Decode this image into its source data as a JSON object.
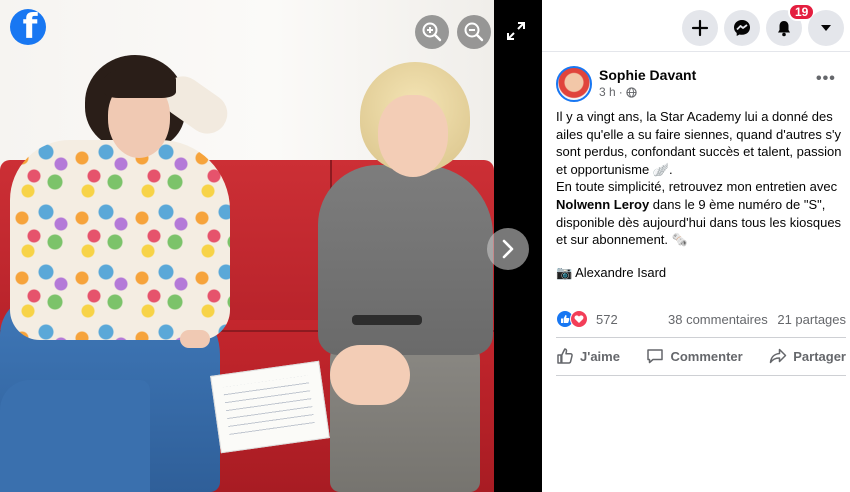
{
  "viewer": {
    "logo_letter": "f",
    "controls": {
      "zoom_in": "zoom-in-icon",
      "zoom_out": "zoom-out-icon",
      "fullscreen": "expand-icon",
      "next": "chevron-right-icon"
    }
  },
  "topbar": {
    "notification_count": "19",
    "icons": [
      "plus-icon",
      "messenger-icon",
      "bell-icon",
      "caret-down-icon"
    ]
  },
  "post": {
    "author": "Sophie Davant",
    "time": "3 h",
    "visibility_icon": "globe-icon",
    "text_line1": "Il y a vingt ans, la Star Academy lui a donné des ailes qu'elle a su faire siennes, quand d'autres s'y sont perdus, confondant succès et talent, passion et opportunisme 🪽.",
    "text_line2_pre": "En toute simplicité, retrouvez mon entretien avec ",
    "text_line2_bold": "Nolwenn Leroy",
    "text_line2_post": " dans le 9 ème numéro de \"S\", disponible dès aujourd'hui dans tous les kiosques et sur abonnement. 🗞️",
    "photo_credit": "📷 Alexandre Isard",
    "reaction_count": "572",
    "comments": "38 commentaires",
    "shares": "21 partages",
    "actions": {
      "like": "J'aime",
      "comment": "Commenter",
      "share": "Partager"
    }
  },
  "colors": {
    "brand": "#1877f2",
    "badge": "#e41e3f",
    "love": "#f33e58"
  }
}
